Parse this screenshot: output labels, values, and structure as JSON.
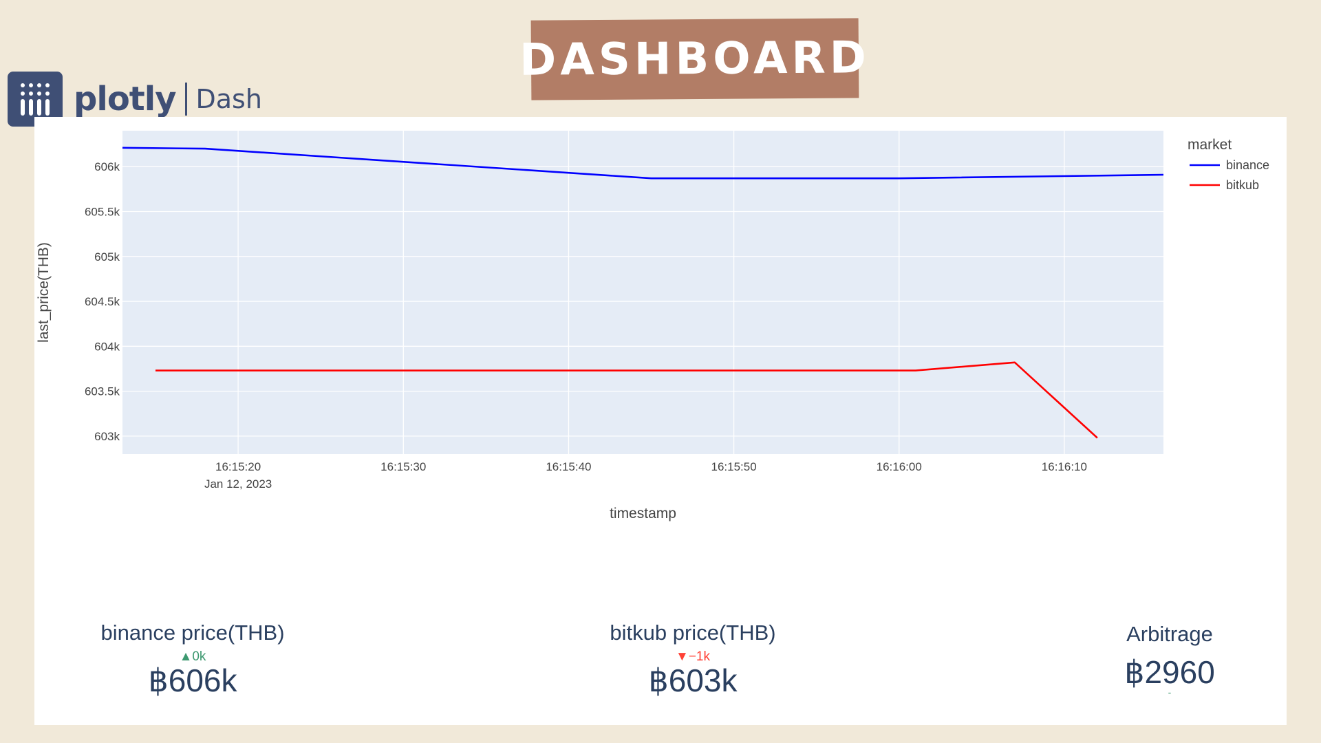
{
  "banner": {
    "title": "DASHBOARD"
  },
  "logo": {
    "word": "plotly",
    "product": "Dash"
  },
  "chart_data": {
    "type": "line",
    "xlabel": "timestamp",
    "ylabel": "last_price(THB)",
    "x_tick_labels": [
      "16:15:20",
      "16:15:30",
      "16:15:40",
      "16:15:50",
      "16:16:00",
      "16:16:10"
    ],
    "x_tick_sublabel": "Jan 12, 2023",
    "x_range": [
      "2023-01-12 16:15:13",
      "2023-01-12 16:16:16"
    ],
    "y_ticks": [
      603000,
      603500,
      604000,
      604500,
      605000,
      605500,
      606000
    ],
    "y_tick_labels": [
      "603k",
      "603.5k",
      "604k",
      "604.5k",
      "605k",
      "605.5k",
      "606k"
    ],
    "ylim": [
      602800,
      606400
    ],
    "legend_title": "market",
    "legend_position": "top-right",
    "grid": true,
    "series": [
      {
        "name": "binance",
        "color": "#0000ff",
        "points": [
          {
            "x": "2023-01-12 16:15:13",
            "y": 606210
          },
          {
            "x": "2023-01-12 16:15:18",
            "y": 606200
          },
          {
            "x": "2023-01-12 16:15:45",
            "y": 605870
          },
          {
            "x": "2023-01-12 16:16:00",
            "y": 605870
          },
          {
            "x": "2023-01-12 16:16:16",
            "y": 605910
          }
        ]
      },
      {
        "name": "bitkub",
        "color": "#ff0000",
        "points": [
          {
            "x": "2023-01-12 16:15:15",
            "y": 603730
          },
          {
            "x": "2023-01-12 16:16:01",
            "y": 603730
          },
          {
            "x": "2023-01-12 16:16:07",
            "y": 603820
          },
          {
            "x": "2023-01-12 16:16:12",
            "y": 602980
          }
        ]
      }
    ]
  },
  "metrics": {
    "binance": {
      "title": "binance price(THB)",
      "delta": "▲0k",
      "value": "฿606k"
    },
    "bitkub": {
      "title": "bitkub price(THB)",
      "delta": "▼−1k",
      "value": "฿603k"
    },
    "arbitrage": {
      "title": "Arbitrage",
      "value": "฿2960",
      "delta": "-"
    }
  }
}
